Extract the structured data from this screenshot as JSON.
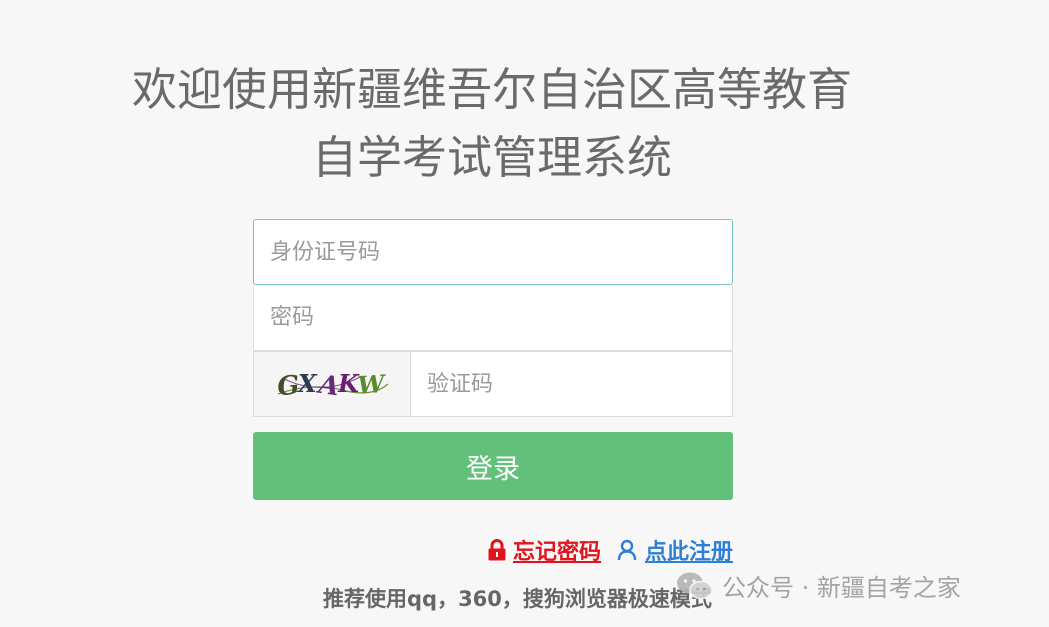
{
  "header": {
    "title_line1": "欢迎使用新疆维吾尔自治区高等教育",
    "title_line2": "自学考试管理系统"
  },
  "form": {
    "id_placeholder": "身份证号码",
    "password_placeholder": "密码",
    "captcha_placeholder": "验证码",
    "captcha_text": "GXAKW",
    "login_label": "登录"
  },
  "links": {
    "forgot_password": "忘记密码",
    "register": "点此注册"
  },
  "footer": {
    "recommend": "推荐使用qq，360，搜狗浏览器极速模式"
  },
  "watermark": {
    "text": "公众号 · 新疆自考之家"
  },
  "colors": {
    "background": "#f7f7f7",
    "title": "#6a6a6a",
    "login_button": "#63c07a",
    "forgot_link": "#e0141e",
    "register_link": "#2f7fd3",
    "focus_border": "#7cc2c7"
  }
}
